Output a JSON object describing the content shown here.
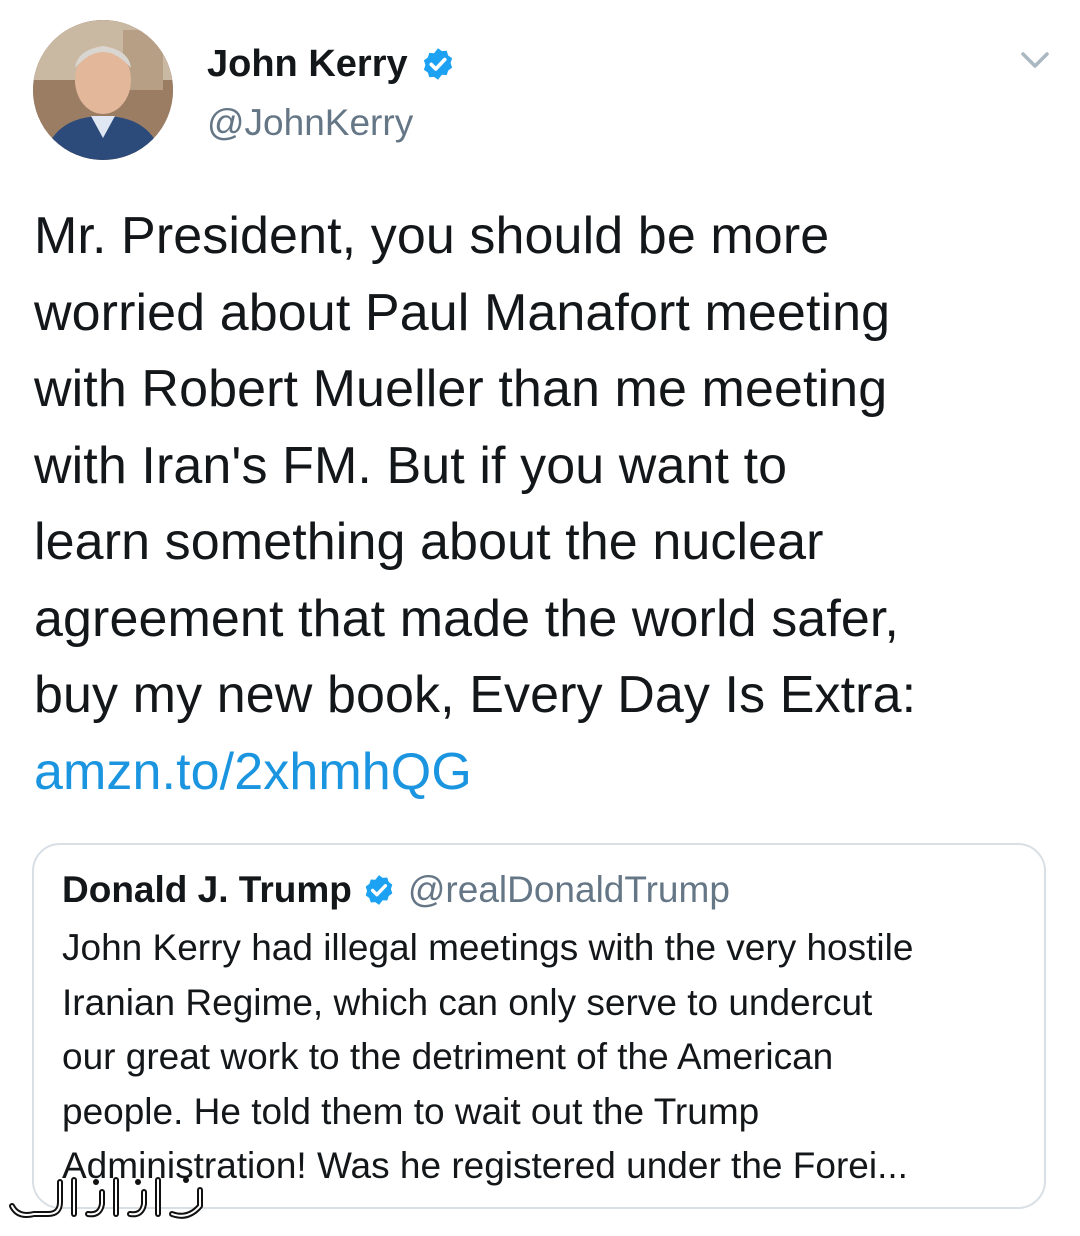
{
  "author": {
    "name": "John Kerry",
    "handle": "@JohnKerry"
  },
  "tweet": {
    "lines": [
      "Mr. President, you should be more",
      "worried about Paul Manafort meeting",
      "with Robert Mueller than me meeting",
      "with Iran's FM. But if you want to",
      "learn something about the nuclear",
      "agreement that made the world safer,",
      "buy my new book, Every Day Is Extra:"
    ],
    "link": "amzn.to/2xhmhQG"
  },
  "quoted_tweet": {
    "name": "Donald J. Trump",
    "handle": "@realDonaldTrump",
    "lines": [
      "John Kerry had illegal meetings with the very hostile",
      "Iranian Regime, which can only serve to undercut",
      "our great work to the detriment of the American",
      "people. He told them to wait out the Trump",
      "Administration! Was he registered under the Forei..."
    ]
  },
  "watermark": {
    "text": "جوانان"
  },
  "colors": {
    "verified_badge": "#1da1f2",
    "link": "#1b95e0",
    "secondary_text": "#657786",
    "border": "#d8dfe5"
  },
  "icons": {
    "verified": "verified-badge-icon",
    "caret": "chevron-down-icon"
  }
}
